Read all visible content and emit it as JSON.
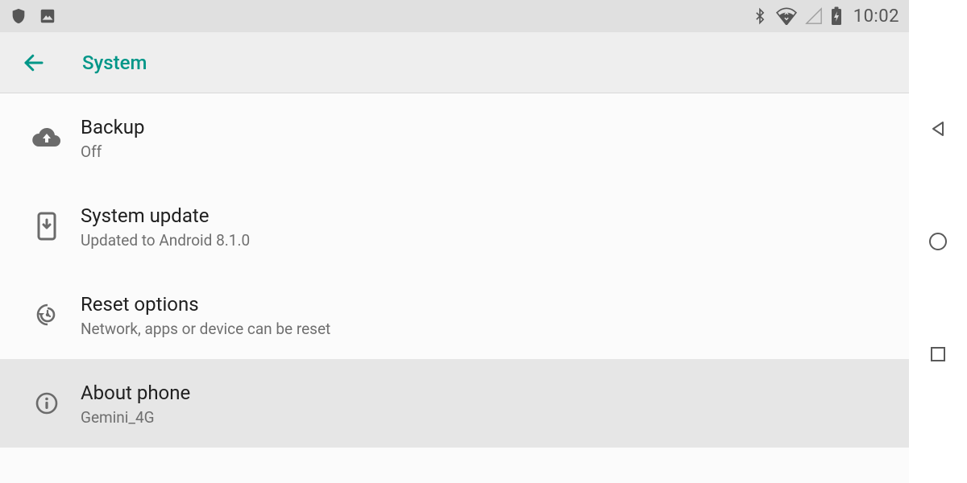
{
  "statusbar": {
    "clock": "10:02"
  },
  "appbar": {
    "title": "System"
  },
  "items": [
    {
      "title": "Backup",
      "subtitle": "Off"
    },
    {
      "title": "System update",
      "subtitle": "Updated to Android 8.1.0"
    },
    {
      "title": "Reset options",
      "subtitle": "Network, apps or device can be reset"
    },
    {
      "title": "About phone",
      "subtitle": "Gemini_4G"
    }
  ]
}
